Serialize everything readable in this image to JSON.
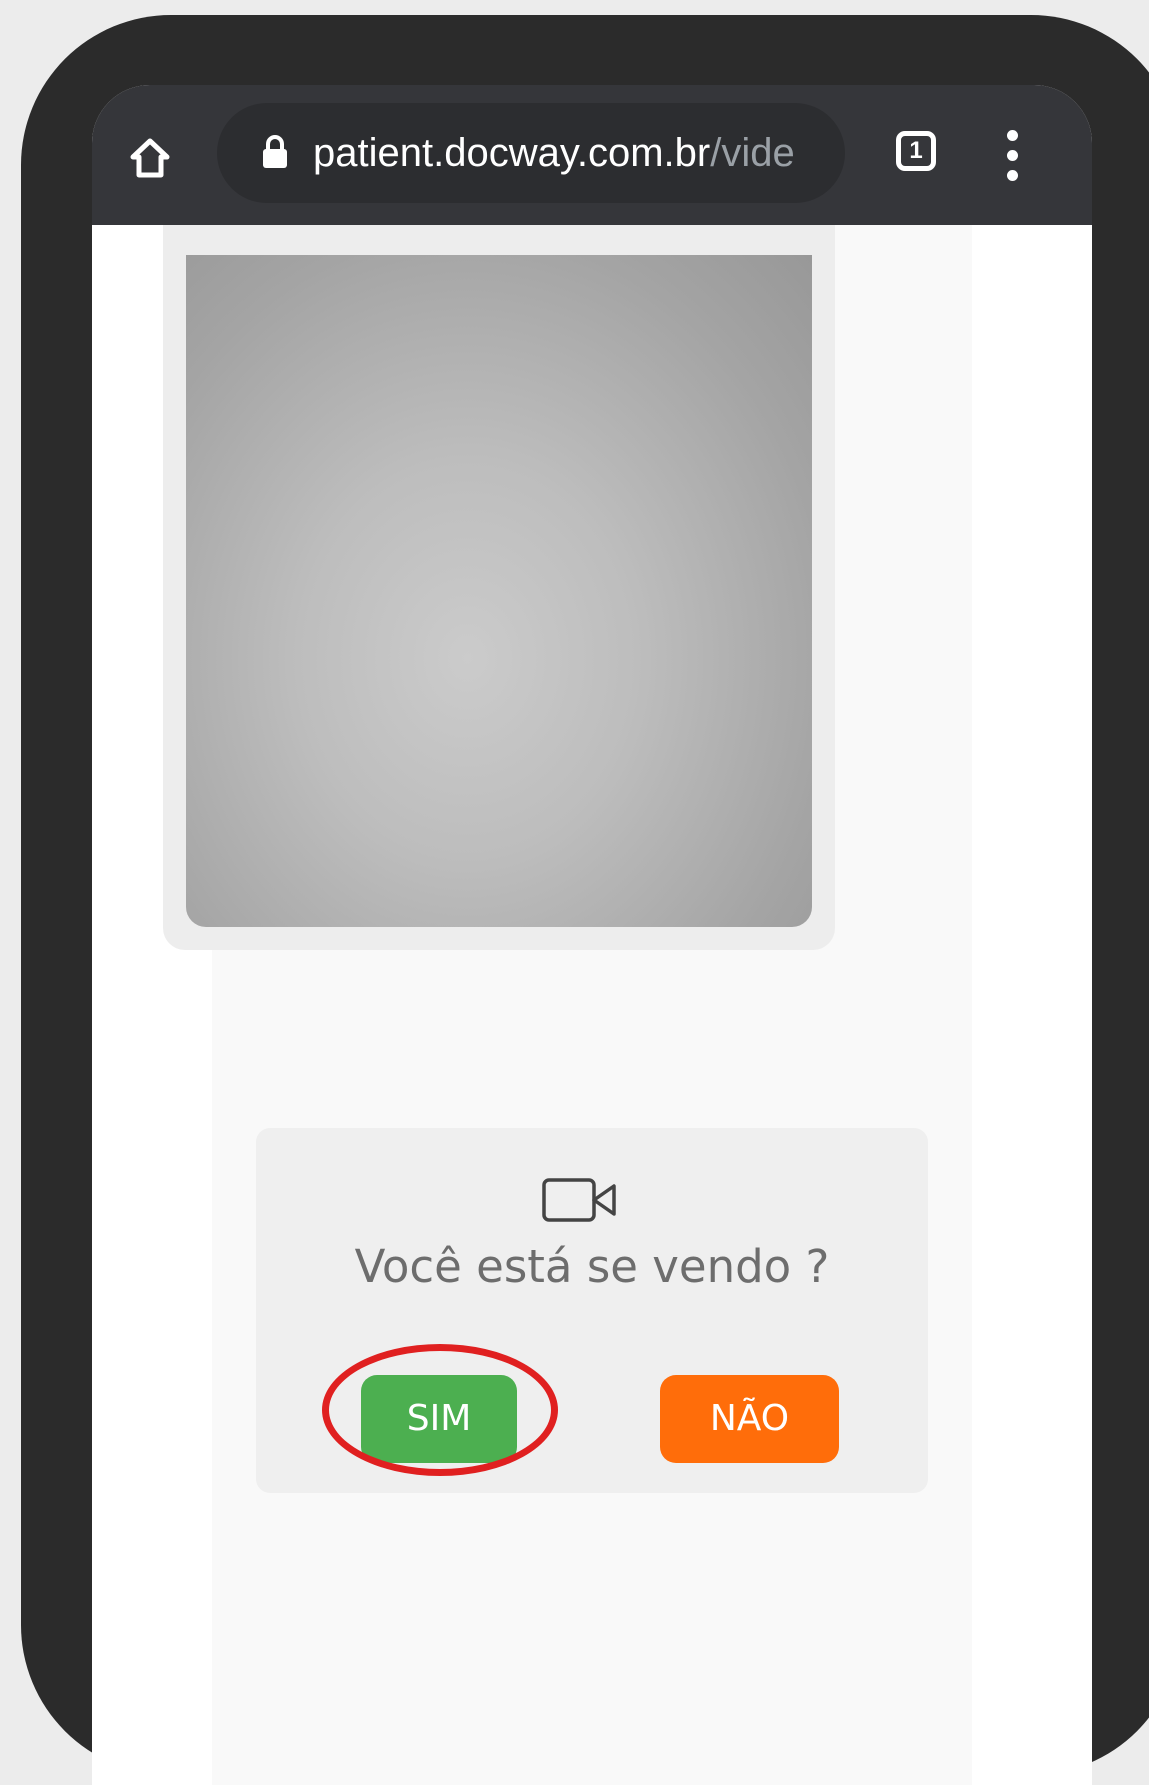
{
  "browser": {
    "url_host": "patient.docway.com.br",
    "url_path": "/vide",
    "tab_count": "1",
    "icons": {
      "home": "home-icon",
      "lock": "lock-icon",
      "menu": "more-vert-icon"
    }
  },
  "prompt": {
    "icon": "video-camera-icon",
    "question": "Você está se vendo ?",
    "yes_label": "SIM",
    "no_label": "NÃO"
  },
  "colors": {
    "yes_button": "#4caf50",
    "no_button": "#ff6d0a",
    "highlight": "#e02020",
    "toolbar": "#35363a"
  }
}
